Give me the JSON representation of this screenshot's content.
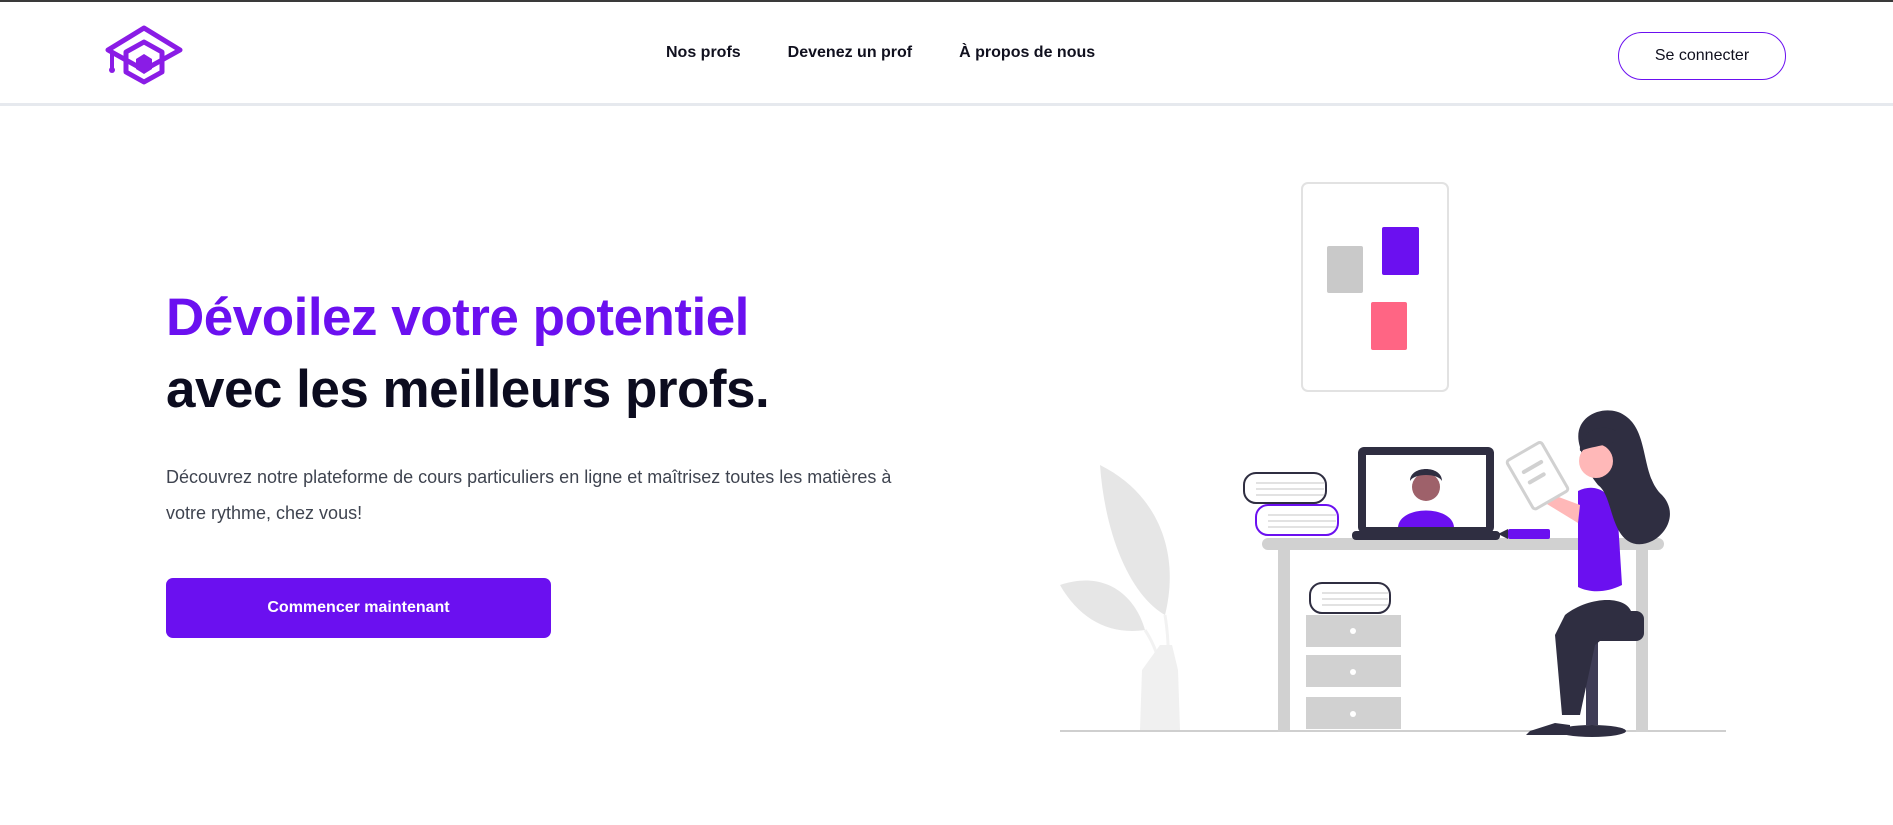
{
  "header": {
    "logo_icon": "graduation-hexagon-logo",
    "nav": [
      {
        "label": "Nos profs"
      },
      {
        "label": "Devenez un prof"
      },
      {
        "label": "À propos de nous"
      }
    ],
    "login_label": "Se connecter"
  },
  "hero": {
    "title_line1": "Dévoilez votre potentiel",
    "title_line2": "avec les meilleurs profs.",
    "description": "Découvrez notre plateforme de cours particuliers en ligne et maîtrisez toutes les matières à votre rythme, chez vous!",
    "cta_label": "Commencer maintenant"
  },
  "colors": {
    "accent": "#6b10f0",
    "heading_dark": "#0c0c1f",
    "pink": "#ff6584",
    "dark": "#2f2e41"
  }
}
